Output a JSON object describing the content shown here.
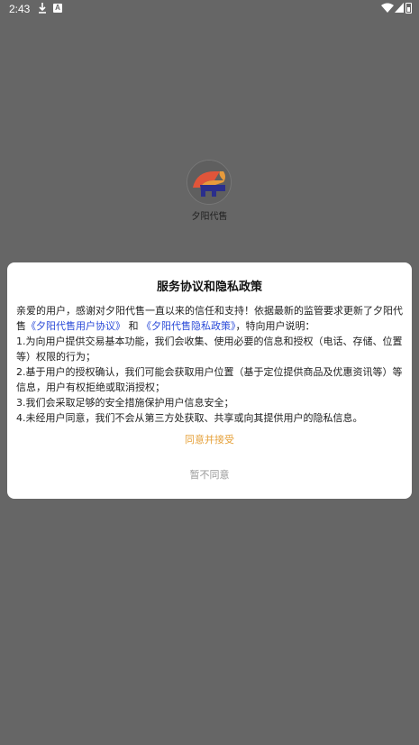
{
  "status_bar": {
    "time": "2:43",
    "icons": [
      "download-icon",
      "a-notification-icon",
      "wifi-icon",
      "signal-icon",
      "battery-icon"
    ]
  },
  "splash": {
    "app_name": "夕阳代售"
  },
  "dialog": {
    "title": "服务协议和隐私政策",
    "intro_prefix": "亲爱的用户，感谢对夕阳代售一直以来的信任和支持！依据最新的监管要求更新了夕阳代售",
    "user_agreement_link": "《夕阳代售用户协议》",
    "and_text": "和",
    "privacy_policy_link": "《夕阳代售隐私政策》",
    "intro_suffix": "，特向用户说明：",
    "items": [
      "1.为向用户提供交易基本功能，我们会收集、使用必要的信息和授权（电话、存储、位置等）权限的行为；",
      "2.基于用户的授权确认，我们可能会获取用户位置（基于定位提供商品及优惠资讯等）等信息，用户有权拒绝或取消授权；",
      "3.我们会采取足够的安全措施保护用户信息安全；",
      "4.未经用户同意，我们不会从第三方处获取、共享或向其提供用户的隐私信息。"
    ],
    "agree_label": "同意并接受",
    "decline_label": "暂不同意"
  },
  "colors": {
    "overlay": "#666666",
    "link": "#2b4bd8",
    "agree": "#e6a23c",
    "decline": "#999999"
  }
}
